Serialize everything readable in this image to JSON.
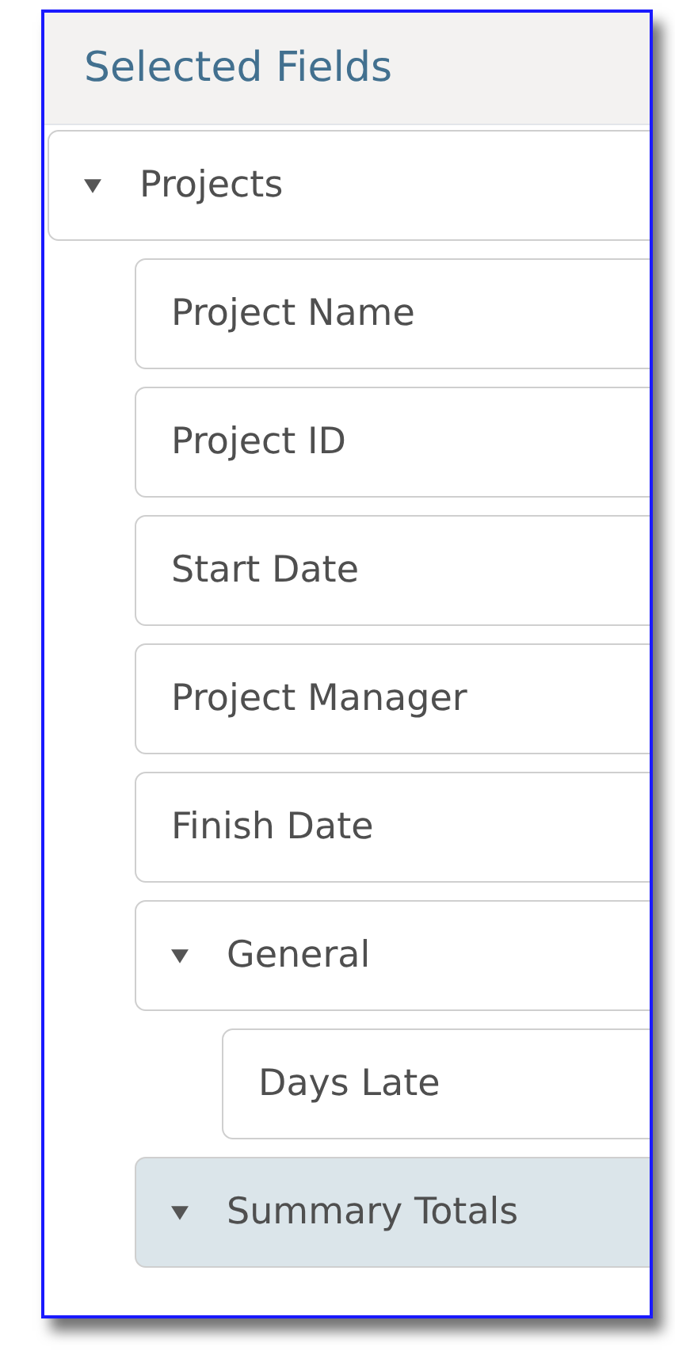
{
  "panel": {
    "title": "Selected Fields"
  },
  "tree": [
    {
      "label": "Projects",
      "expanded": true,
      "selected": false,
      "children": [
        {
          "label": "Project Name",
          "selected": false
        },
        {
          "label": "Project ID",
          "selected": false
        },
        {
          "label": "Start Date",
          "selected": false
        },
        {
          "label": "Project Manager",
          "selected": false
        },
        {
          "label": "Finish Date",
          "selected": false
        },
        {
          "label": "General",
          "expanded": true,
          "selected": false,
          "children": [
            {
              "label": "Days Late",
              "selected": false
            }
          ]
        },
        {
          "label": "Summary Totals",
          "expanded": true,
          "selected": true
        }
      ]
    }
  ]
}
